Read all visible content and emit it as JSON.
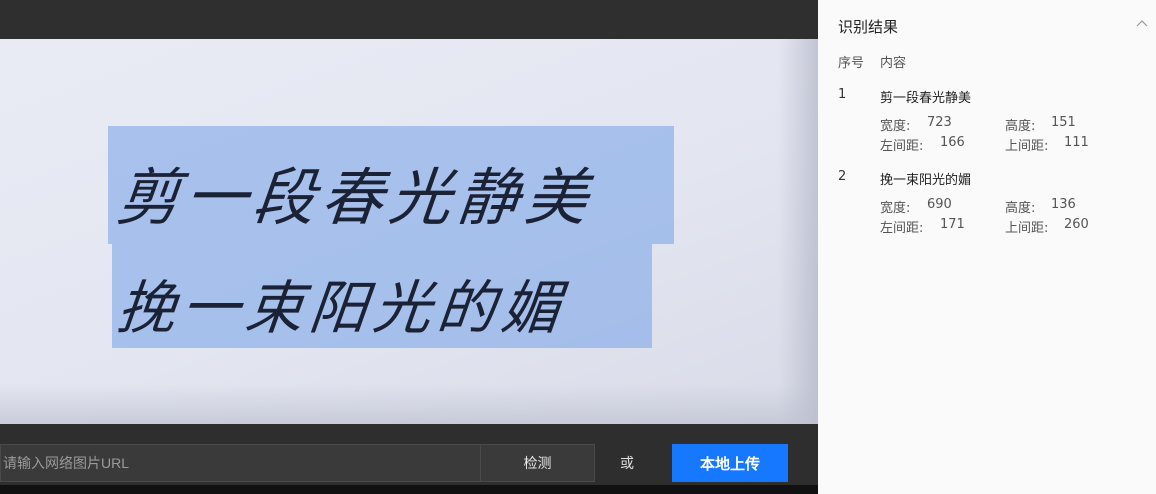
{
  "stage": {
    "handwriting_lines": [
      "剪一段春光静美",
      "挽一束阳光的媚"
    ],
    "url_placeholder": "请输入网络图片URL",
    "detect_label": "检测",
    "or_label": "或",
    "upload_label": "本地上传"
  },
  "panel": {
    "title": "识别结果",
    "col_index": "序号",
    "col_content": "内容",
    "rows": [
      {
        "index": "1",
        "text": "剪一段春光静美",
        "width_label": "宽度:",
        "width": "723",
        "height_label": "高度:",
        "height": "151",
        "left_label": "左间距:",
        "left": "166",
        "top_label": "上间距:",
        "top": "111"
      },
      {
        "index": "2",
        "text": "挽一束阳光的媚",
        "width_label": "宽度:",
        "width": "690",
        "height_label": "高度:",
        "height": "136",
        "left_label": "左间距:",
        "left": "171",
        "top_label": "上间距:",
        "top": "260"
      }
    ]
  },
  "colors": {
    "accent": "#1677ff",
    "highlight": "#74a0e8"
  },
  "icons": {
    "collapse": "chevron-up-icon"
  }
}
